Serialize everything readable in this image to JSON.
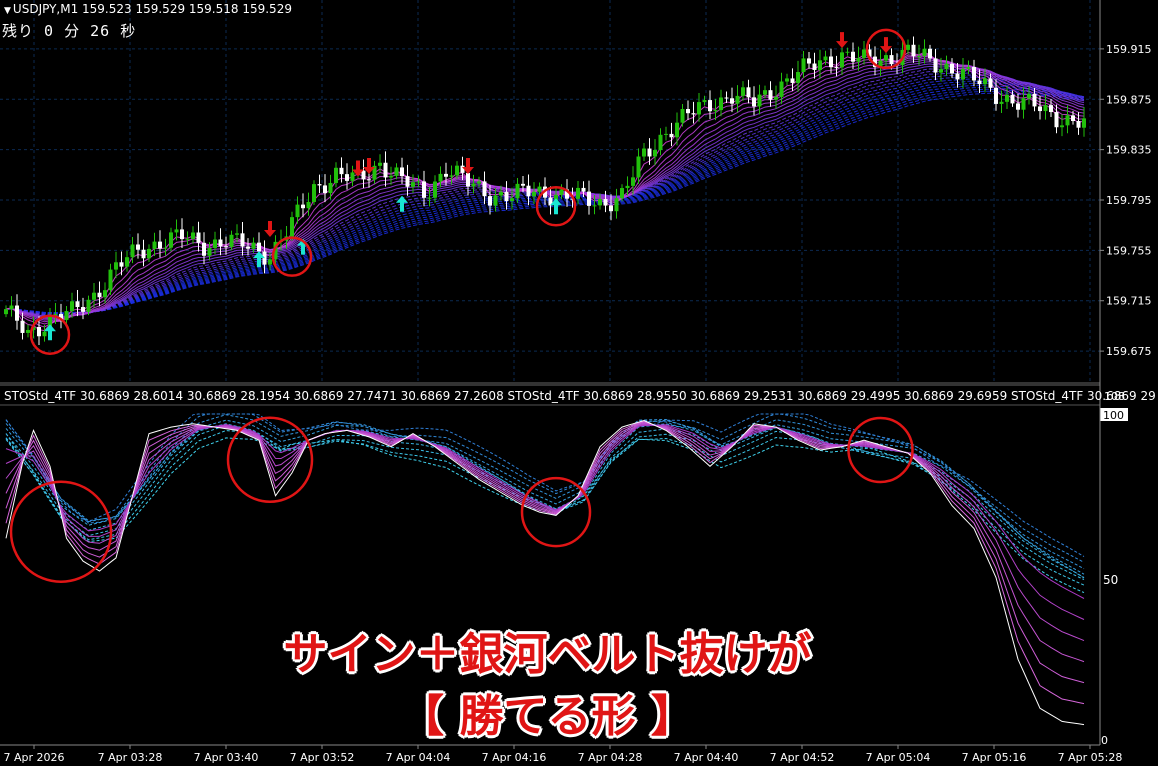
{
  "header": {
    "symbol_line": "USDJPY,M1  159.523 159.529 159.518 159.529",
    "timer": "残り 0 分 26 秒"
  },
  "indicator": {
    "label": "STOStd_4TF 30.6869 28.6014 30.6869 28.1954 30.6869 27.7471 30.6869 27.2608  STOStd_4TF 30.6869 28.9550 30.6869 29.2531 30.6869 29.4995 30.6869 29.6959  STOStd_4TF 30.6869 29",
    "scale_top": "108",
    "level_100": "100",
    "level_50": "50",
    "level_0": "0"
  },
  "caption": {
    "line1": "サイン＋銀河ベルト抜けが",
    "line2": "【 勝てる形 】"
  },
  "colors": {
    "up_candle": "#22c00c",
    "down_candle": "#ffffff",
    "up_arrow": "#19e6d2",
    "down_arrow": "#e01515",
    "belt_fast": "#d640d6",
    "belt_slow": "#1a2de0",
    "circle": "#e01515",
    "grid": "#0b2a52"
  },
  "chart_data": [
    {
      "type": "candlestick",
      "symbol": "USDJPY",
      "timeframe": "M1",
      "y_ticks": [
        159.675,
        159.715,
        159.755,
        159.795,
        159.835,
        159.875,
        159.915
      ],
      "ylim": [
        159.66,
        159.93
      ],
      "x_ticks": [
        "7 Apr 2026",
        "7 Apr 03:28",
        "7 Apr 03:40",
        "7 Apr 03:52",
        "7 Apr 04:04",
        "7 Apr 04:16",
        "7 Apr 04:28",
        "7 Apr 04:40",
        "7 Apr 04:52",
        "7 Apr 05:04",
        "7 Apr 05:16",
        "7 Apr 05:28"
      ],
      "close_path": [
        [
          0,
          159.705
        ],
        [
          4,
          159.69
        ],
        [
          8,
          159.7
        ],
        [
          12,
          159.705
        ],
        [
          16,
          159.72
        ],
        [
          20,
          159.74
        ],
        [
          24,
          159.755
        ],
        [
          28,
          159.762
        ],
        [
          32,
          159.765
        ],
        [
          36,
          159.76
        ],
        [
          40,
          159.762
        ],
        [
          44,
          159.758
        ],
        [
          48,
          159.752
        ],
        [
          52,
          159.775
        ],
        [
          56,
          159.805
        ],
        [
          60,
          159.815
        ],
        [
          64,
          159.81
        ],
        [
          68,
          159.825
        ],
        [
          72,
          159.81
        ],
        [
          76,
          159.8
        ],
        [
          80,
          159.82
        ],
        [
          84,
          159.808
        ],
        [
          88,
          159.8
        ],
        [
          92,
          159.798
        ],
        [
          96,
          159.802
        ],
        [
          100,
          159.8
        ],
        [
          104,
          159.796
        ],
        [
          108,
          159.793
        ],
        [
          112,
          159.798
        ],
        [
          116,
          159.83
        ],
        [
          120,
          159.85
        ],
        [
          124,
          159.862
        ],
        [
          128,
          159.872
        ],
        [
          132,
          159.878
        ],
        [
          136,
          159.872
        ],
        [
          140,
          159.885
        ],
        [
          144,
          159.895
        ],
        [
          148,
          159.905
        ],
        [
          152,
          159.91
        ],
        [
          156,
          159.905
        ],
        [
          160,
          159.908
        ],
        [
          164,
          159.912
        ],
        [
          168,
          159.905
        ],
        [
          172,
          159.9
        ],
        [
          176,
          159.89
        ],
        [
          180,
          159.88
        ],
        [
          184,
          159.872
        ],
        [
          188,
          159.868
        ],
        [
          192,
          159.86
        ],
        [
          196,
          159.855
        ]
      ],
      "buy_signals": [
        [
          8,
          159.69
        ],
        [
          46,
          159.748
        ],
        [
          54,
          159.758
        ],
        [
          72,
          159.792
        ],
        [
          100,
          159.79
        ]
      ],
      "sell_signals": [
        [
          48,
          159.772
        ],
        [
          64,
          159.82
        ],
        [
          66,
          159.822
        ],
        [
          84,
          159.822
        ],
        [
          152,
          159.922
        ],
        [
          160,
          159.918
        ]
      ],
      "highlight_circles": [
        [
          8,
          159.688
        ],
        [
          52,
          159.75
        ],
        [
          100,
          159.79
        ],
        [
          160,
          159.915
        ]
      ]
    },
    {
      "type": "line",
      "name": "STOStd_4TF",
      "ylim": [
        0,
        100
      ],
      "y_ticks": [
        0,
        50,
        100
      ],
      "fast_line": [
        [
          0,
          62
        ],
        [
          3,
          85
        ],
        [
          5,
          95
        ],
        [
          8,
          84
        ],
        [
          11,
          62
        ],
        [
          14,
          55
        ],
        [
          17,
          52
        ],
        [
          20,
          56
        ],
        [
          23,
          75
        ],
        [
          26,
          94
        ],
        [
          30,
          96
        ],
        [
          34,
          97
        ],
        [
          38,
          96
        ],
        [
          42,
          95
        ],
        [
          46,
          92
        ],
        [
          49,
          75
        ],
        [
          52,
          82
        ],
        [
          55,
          92
        ],
        [
          58,
          94
        ],
        [
          62,
          95
        ],
        [
          66,
          93
        ],
        [
          70,
          90
        ],
        [
          74,
          94
        ],
        [
          78,
          90
        ],
        [
          82,
          85
        ],
        [
          86,
          80
        ],
        [
          90,
          76
        ],
        [
          94,
          72
        ],
        [
          97,
          70
        ],
        [
          100,
          69
        ],
        [
          104,
          75
        ],
        [
          108,
          90
        ],
        [
          112,
          96
        ],
        [
          116,
          98
        ],
        [
          120,
          95
        ],
        [
          124,
          90
        ],
        [
          128,
          84
        ],
        [
          132,
          90
        ],
        [
          136,
          97
        ],
        [
          140,
          96
        ],
        [
          144,
          92
        ],
        [
          148,
          89
        ],
        [
          152,
          90
        ],
        [
          156,
          92
        ],
        [
          160,
          90
        ],
        [
          164,
          88
        ],
        [
          168,
          82
        ],
        [
          172,
          72
        ],
        [
          176,
          65
        ],
        [
          180,
          50
        ],
        [
          184,
          25
        ],
        [
          188,
          10
        ],
        [
          192,
          6
        ],
        [
          196,
          5
        ]
      ],
      "slow_line": [
        [
          0,
          94
        ],
        [
          5,
          84
        ],
        [
          10,
          72
        ],
        [
          15,
          66
        ],
        [
          20,
          68
        ],
        [
          25,
          78
        ],
        [
          30,
          88
        ],
        [
          35,
          95
        ],
        [
          40,
          97
        ],
        [
          45,
          95
        ],
        [
          50,
          90
        ],
        [
          55,
          92
        ],
        [
          60,
          95
        ],
        [
          65,
          95
        ],
        [
          70,
          93
        ],
        [
          75,
          92
        ],
        [
          80,
          90
        ],
        [
          85,
          85
        ],
        [
          90,
          80
        ],
        [
          95,
          75
        ],
        [
          100,
          71
        ],
        [
          105,
          75
        ],
        [
          110,
          88
        ],
        [
          115,
          96
        ],
        [
          120,
          97
        ],
        [
          125,
          95
        ],
        [
          130,
          90
        ],
        [
          135,
          93
        ],
        [
          140,
          96
        ],
        [
          145,
          94
        ],
        [
          150,
          91
        ],
        [
          155,
          90
        ],
        [
          160,
          89
        ],
        [
          165,
          88
        ],
        [
          170,
          84
        ],
        [
          175,
          78
        ],
        [
          180,
          70
        ],
        [
          185,
          62
        ],
        [
          190,
          56
        ],
        [
          196,
          50
        ]
      ],
      "highlight_circles": [
        [
          10,
          64
        ],
        [
          48,
          86
        ],
        [
          100,
          70
        ],
        [
          159,
          89
        ]
      ]
    }
  ]
}
